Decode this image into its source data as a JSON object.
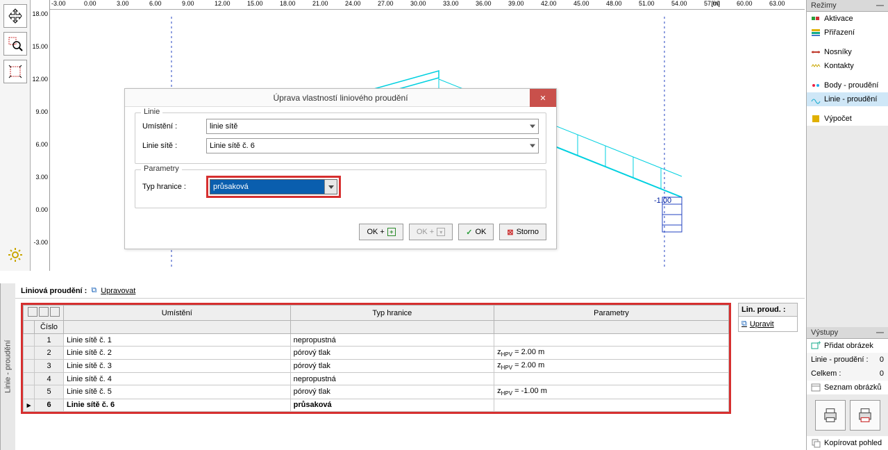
{
  "ruler": {
    "top": [
      "-3.00",
      "0.00",
      "3.00",
      "6.00",
      "9.00",
      "12.00",
      "15.00",
      "18.00",
      "21.00",
      "24.00",
      "27.00",
      "30.00",
      "33.00",
      "36.00",
      "39.00",
      "42.00",
      "45.00",
      "48.00",
      "51.00",
      "54.00",
      "57.00",
      "60.00",
      "63.00"
    ],
    "unit": "[m]",
    "left": [
      "18.00",
      "15.00",
      "12.00",
      "9.00",
      "6.00",
      "3.00",
      "0.00",
      "-3.00"
    ]
  },
  "dialog": {
    "title": "Úprava vlastností liniového proudění",
    "close": "✕",
    "linie_legend": "Linie",
    "umisteni_label": "Umístění :",
    "umisteni_value": "linie sítě",
    "linie_site_label": "Linie sítě :",
    "linie_site_value": "Linie sítě č. 6",
    "param_legend": "Parametry",
    "typ_label": "Typ hranice :",
    "typ_value": "průsaková",
    "ok_plus": "OK +",
    "ok_down": "OK +",
    "ok": "OK",
    "storno": "Storno"
  },
  "modes": {
    "header": "Režimy",
    "items": [
      "Aktivace",
      "Přiřazení",
      "Nosníky",
      "Kontakty",
      "Body - proudění",
      "Linie - proudění",
      "Výpočet"
    ]
  },
  "outputs": {
    "header": "Výstupy",
    "add_image": "Přidat obrázek",
    "rows": [
      {
        "l": "Linie - proudění :",
        "v": "0"
      },
      {
        "l": "Celkem :",
        "v": "0"
      }
    ],
    "list_images": "Seznam obrázků",
    "copy_view": "Kopírovat pohled"
  },
  "bottom": {
    "title": "Liniová proudění :",
    "edit": "Upravovat",
    "vtab": "Linie - proudění",
    "headers": {
      "h1": "Umístění",
      "h2": "Typ hranice",
      "h3": "Parametry",
      "h0": "Číslo"
    },
    "rows": [
      {
        "n": "1",
        "u": "Linie sítě č. 1",
        "t": "nepropustná",
        "p": ""
      },
      {
        "n": "2",
        "u": "Linie sítě č. 2",
        "t": "pórový tlak",
        "p": "zHPV = 2.00 m"
      },
      {
        "n": "3",
        "u": "Linie sítě č. 3",
        "t": "pórový tlak",
        "p": "zHPV = 2.00 m"
      },
      {
        "n": "4",
        "u": "Linie sítě č. 4",
        "t": "nepropustná",
        "p": ""
      },
      {
        "n": "5",
        "u": "Linie sítě č. 5",
        "t": "pórový tlak",
        "p": "zHPV = -1.00 m"
      },
      {
        "n": "6",
        "u": "Linie sítě č. 6",
        "t": "průsaková",
        "p": ""
      }
    ],
    "side": {
      "title": "Lin. proud. :",
      "btn": "Upravit"
    }
  },
  "annotation": "-1.00"
}
